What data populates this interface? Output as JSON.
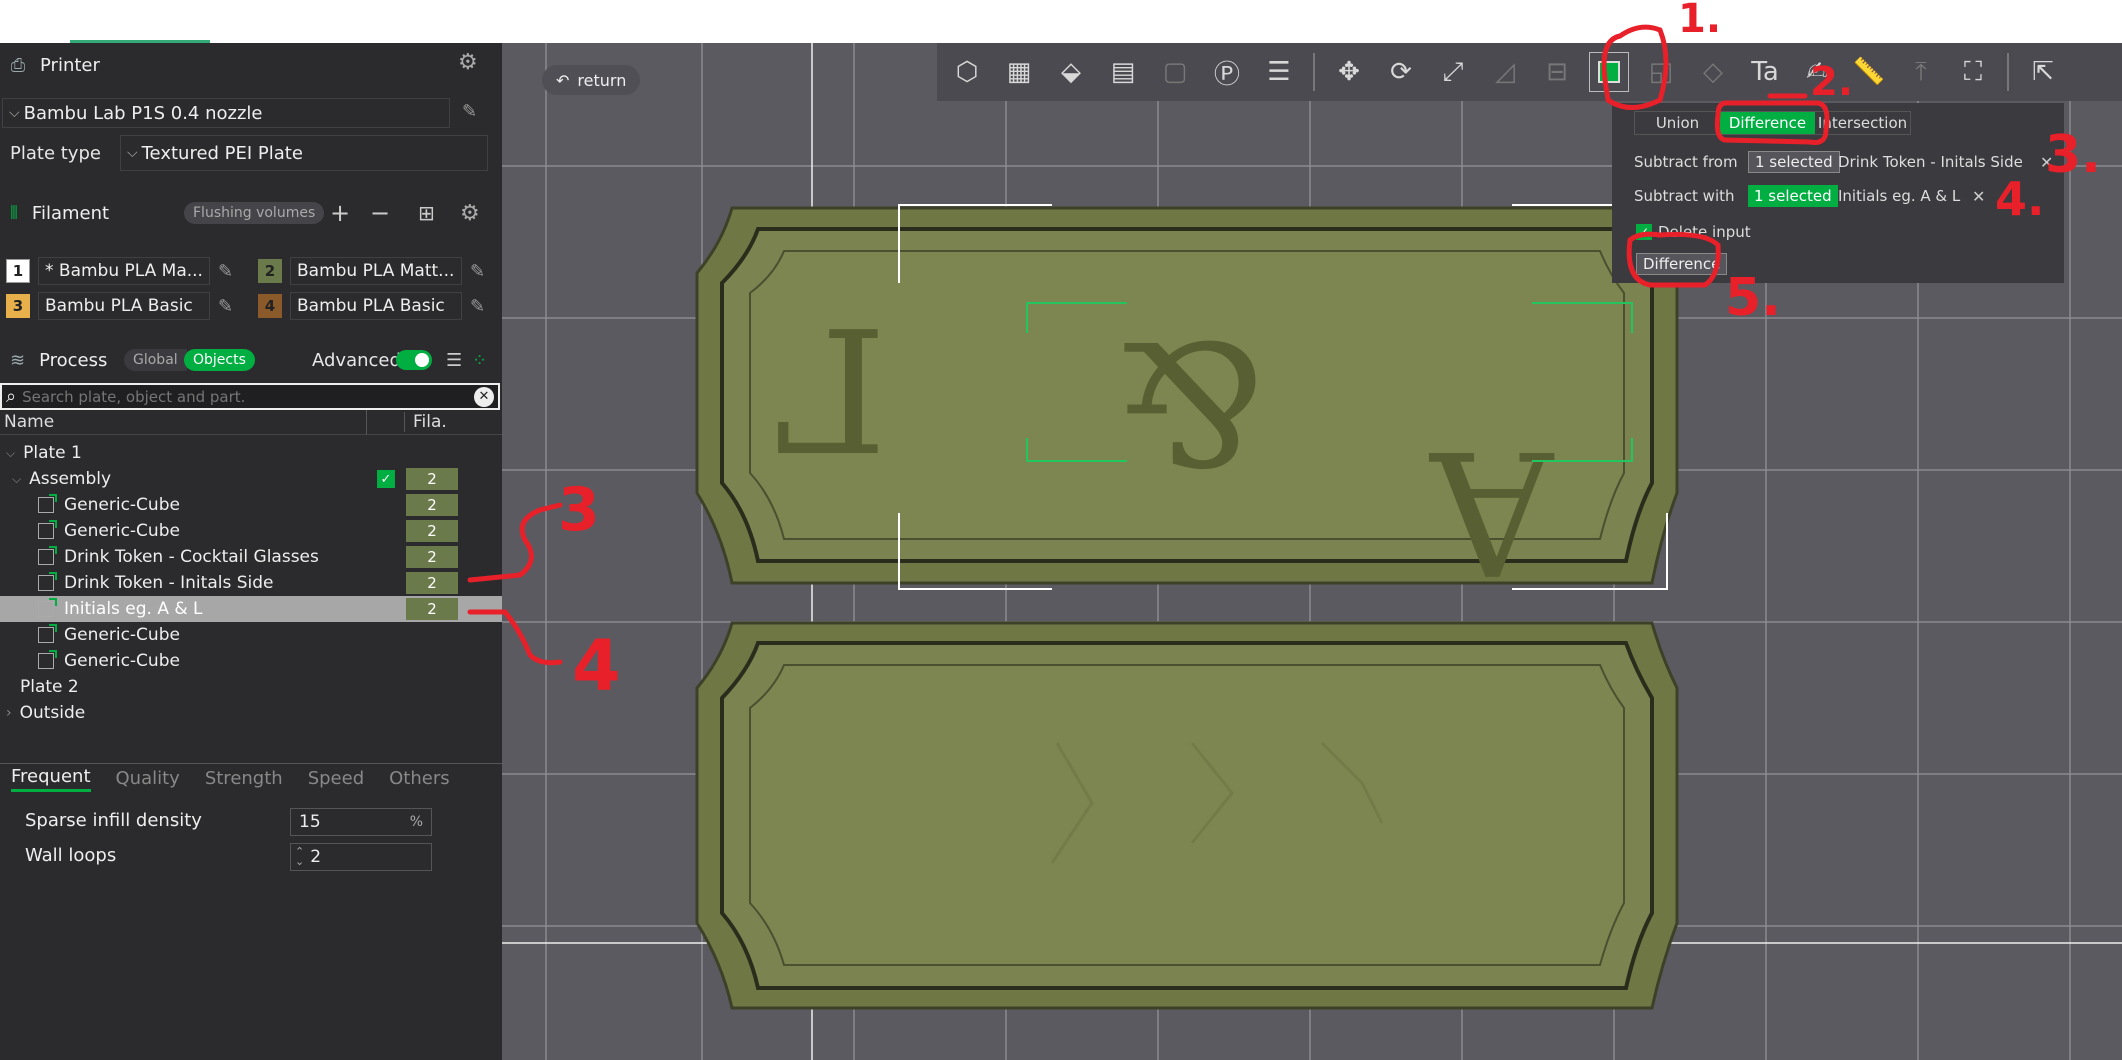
{
  "printer": {
    "title": "Printer",
    "model": "Bambu Lab P1S 0.4 nozzle",
    "plate_type_label": "Plate type",
    "plate_type_value": "Textured PEI Plate"
  },
  "filament": {
    "title": "Filament",
    "flushing_label": "Flushing volumes",
    "items": [
      {
        "num": "1",
        "color": "#ffffff",
        "name": "* Bambu PLA Ma..."
      },
      {
        "num": "2",
        "color": "#6b7a4a",
        "name": "Bambu PLA Matt..."
      },
      {
        "num": "3",
        "color": "#e8b04a",
        "name": "Bambu PLA Basic"
      },
      {
        "num": "4",
        "color": "#8a5a2a",
        "name": "Bambu PLA Basic"
      }
    ]
  },
  "process": {
    "title": "Process",
    "global_label": "Global",
    "objects_label": "Objects",
    "advanced_label": "Advanced",
    "search_placeholder": "Search plate, object and part."
  },
  "tree": {
    "col_name": "Name",
    "col_fila": "Fila.",
    "rows": [
      {
        "label": "Plate 1",
        "fila": ""
      },
      {
        "label": "Assembly",
        "fila": "2"
      },
      {
        "label": "Generic-Cube",
        "fila": "2"
      },
      {
        "label": "Generic-Cube",
        "fila": "2"
      },
      {
        "label": "Drink Token - Cocktail Glasses",
        "fila": "2"
      },
      {
        "label": "Drink Token - Initals Side",
        "fila": "2"
      },
      {
        "label": "Initials eg. A & L",
        "fila": "2"
      },
      {
        "label": "Generic-Cube",
        "fila": ""
      },
      {
        "label": "Generic-Cube",
        "fila": ""
      },
      {
        "label": "Plate 2",
        "fila": ""
      },
      {
        "label": "Outside",
        "fila": ""
      }
    ]
  },
  "settings_tabs": [
    "Frequent",
    "Quality",
    "Strength",
    "Speed",
    "Others"
  ],
  "settings": {
    "sparse_label": "Sparse infill density",
    "sparse_value": "15",
    "sparse_unit": "%",
    "wall_label": "Wall loops",
    "wall_value": "2"
  },
  "viewport": {
    "return_label": "return"
  },
  "boolean": {
    "tabs": [
      "Union",
      "Difference",
      "Intersection"
    ],
    "subtract_from_label": "Subtract from",
    "subtract_from_badge": "1 selected",
    "subtract_from_name": "Drink Token - Initals Side",
    "subtract_with_label": "Subtract with",
    "subtract_with_badge": "1 selected",
    "subtract_with_name": "Initials eg. A & L",
    "delete_input_label": "Delete input",
    "apply_label": "Difference"
  },
  "annotations": {
    "n1": "1.",
    "n2": "2.",
    "n3": "3.",
    "n4": "4.",
    "n5": "5.",
    "side3": "3",
    "side4": "4"
  },
  "colors": {
    "accent": "#00ae42",
    "sidebar_bg": "#2b2b2e",
    "viewport_bg": "#5a5a60",
    "model": "#7d8650",
    "annotation": "#e8202a"
  }
}
